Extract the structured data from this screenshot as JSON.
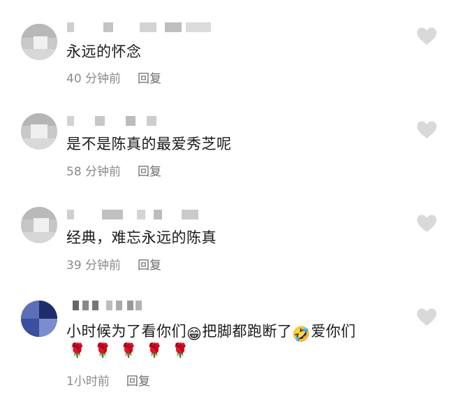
{
  "comments": [
    {
      "text": "永远的怀念",
      "time": "40 分钟前",
      "reply": "回复"
    },
    {
      "text": "是不是陈真的最爱秀芝呢",
      "time": "58 分钟前",
      "reply": "回复"
    },
    {
      "text": "经典，难忘永远的陈真",
      "time": "39 分钟前",
      "reply": "回复"
    },
    {
      "text_part1": "小时候为了看你们",
      "emoji1": "😁",
      "text_part2": "把脚都跑断了",
      "emoji2": "🤣",
      "text_part3": "爱你们",
      "roses": [
        "🌹",
        "🌹",
        "🌹",
        "🌹",
        "🌹"
      ],
      "time": "1小时前",
      "reply": "回复"
    }
  ],
  "icons": {
    "like": "heart-outline-icon"
  },
  "colors": {
    "text": "#1a1a1a",
    "meta": "#8a8a8a",
    "heart": "#d9d9d9"
  }
}
